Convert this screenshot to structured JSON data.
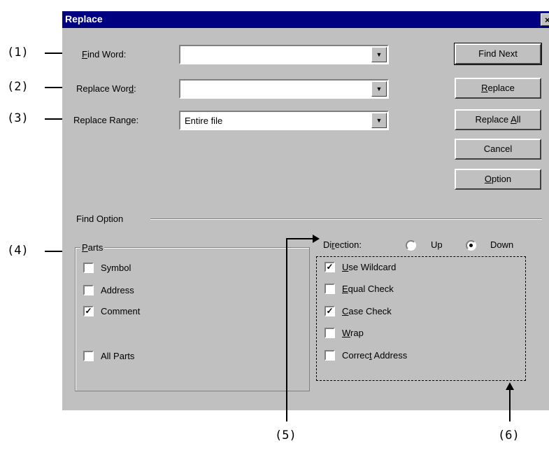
{
  "dialog": {
    "title": "Replace",
    "close_glyph": "×"
  },
  "fields": {
    "find_word_label": "Find Word:",
    "find_word_value": "",
    "replace_word_label": "Replace Word:",
    "replace_word_value": "",
    "replace_range_label": "Replace Range:",
    "replace_range_value": "Entire file",
    "dropdown_glyph": "▼"
  },
  "buttons": {
    "find_next": "Find Next",
    "replace": "Replace",
    "replace_all": "Replace All",
    "cancel": "Cancel",
    "option": "Option"
  },
  "find_option": {
    "title": "Find Option",
    "parts_title": "Parts",
    "parts": [
      {
        "label": "Symbol",
        "checked": false
      },
      {
        "label": "Address",
        "checked": false
      },
      {
        "label": "Comment",
        "checked": true
      },
      {
        "label": "All Parts",
        "checked": false
      }
    ],
    "direction_label": "Direction:",
    "direction_up": "Up",
    "direction_down": "Down",
    "direction_selected": "Down",
    "options": [
      {
        "label": "Use Wildcard",
        "checked": true
      },
      {
        "label": "Equal Check",
        "checked": false
      },
      {
        "label": "Case Check",
        "checked": true
      },
      {
        "label": "Wrap",
        "checked": false
      },
      {
        "label": "Correct Address",
        "checked": false
      }
    ],
    "check_glyph": "✓"
  },
  "callouts": [
    "(1)",
    "(2)",
    "(3)",
    "(4)",
    "(5)",
    "(6)"
  ]
}
